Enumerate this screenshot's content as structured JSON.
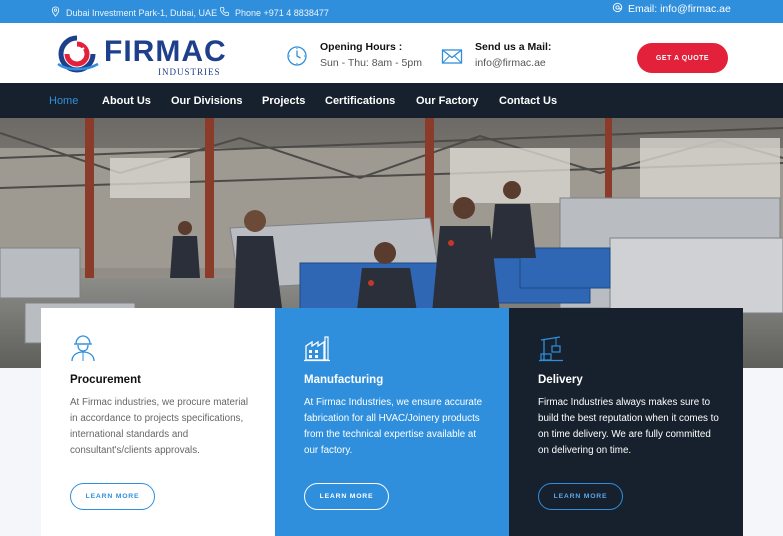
{
  "topbar": {
    "address": "Dubai Investment Park-1, Dubai, UAE",
    "phone": "Phone +971 4 8838477",
    "email": "Email: info@firmac.ae"
  },
  "header": {
    "logo_name": "FIRMAC",
    "logo_sub": "INDUSTRIES",
    "hours_title": "Opening Hours :",
    "hours_text": "Sun - Thu: 8am - 5pm",
    "mail_title": "Send us a Mail:",
    "mail_text": "info@firmac.ae",
    "quote_label": "GET A QUOTE"
  },
  "nav": {
    "items": [
      "Home",
      "About Us",
      "Our Divisions",
      "Projects",
      "Certifications",
      "Our Factory",
      "Contact Us"
    ],
    "active": "Home"
  },
  "cards": [
    {
      "title": "Procurement",
      "desc": "At Firmac industries, we procure material in accordance to projects specifications, international standards and consultant's/clients approvals.",
      "button": "LEARN MORE"
    },
    {
      "title": "Manufacturing",
      "desc": "At Firmac Industries, we ensure accurate fabrication for all HVAC/Joinery products from the technical expertise available at our factory.",
      "button": "LEARN MORE"
    },
    {
      "title": "Delivery",
      "desc": "Firmac Industries always makes sure to build the best reputation when it comes to on time delivery. We are fully committed on delivering on time.",
      "button": "LEARN MORE"
    }
  ],
  "colors": {
    "accent": "#2f8fdc",
    "dark": "#17212e",
    "cta": "#e3213b",
    "brand": "#1e3f8c"
  },
  "icons": [
    "location-icon",
    "phone-icon",
    "email-icon",
    "clock-icon",
    "mail-icon",
    "worker-icon",
    "factory-icon",
    "crane-icon"
  ]
}
